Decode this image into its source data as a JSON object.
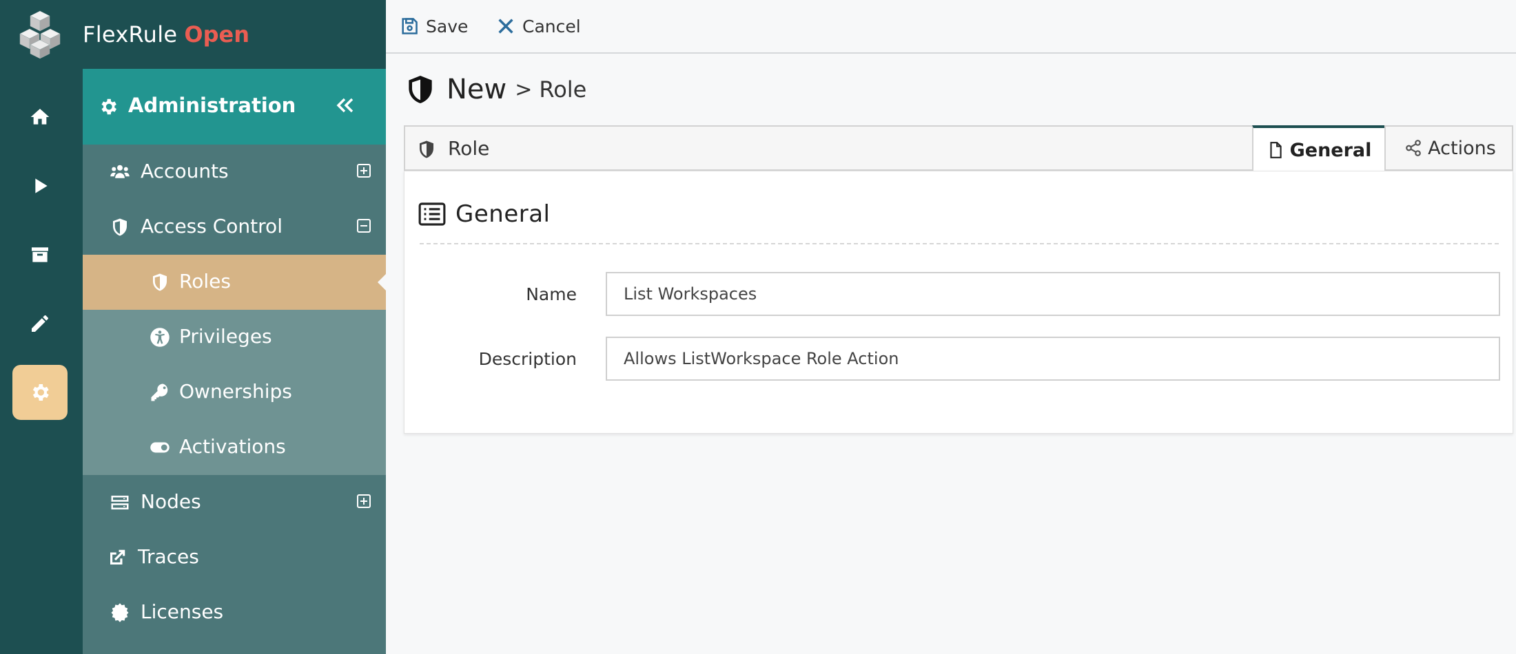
{
  "brand": {
    "name": "FlexRule",
    "accent_word": "Open",
    "colors": {
      "rail": "#1d4f51",
      "accent": "#ea5d52",
      "active": "#f1cd96"
    }
  },
  "rail": {
    "items": [
      {
        "icon": "home-icon",
        "active": false
      },
      {
        "icon": "play-icon",
        "active": false
      },
      {
        "icon": "archive-icon",
        "active": false
      },
      {
        "icon": "pencil-icon",
        "active": false
      },
      {
        "icon": "gear-icon",
        "active": true
      }
    ]
  },
  "sidebar": {
    "title": "Administration",
    "items": [
      {
        "label": "Accounts",
        "icon": "users-icon",
        "toggle": "expand"
      },
      {
        "label": "Access Control",
        "icon": "shield-icon",
        "toggle": "collapse"
      },
      {
        "label": "Roles",
        "icon": "shield-icon",
        "selected": true
      },
      {
        "label": "Privileges",
        "icon": "universal-access-icon"
      },
      {
        "label": "Ownerships",
        "icon": "key-icon"
      },
      {
        "label": "Activations",
        "icon": "toggle-icon"
      },
      {
        "label": "Nodes",
        "icon": "server-icon",
        "toggle": "expand"
      },
      {
        "label": "Traces",
        "icon": "external-link-icon"
      },
      {
        "label": "Licenses",
        "icon": "certificate-icon"
      }
    ]
  },
  "toolbar": {
    "save_label": "Save",
    "cancel_label": "Cancel"
  },
  "page": {
    "title_new": "New",
    "separator": ">",
    "title_entity": "Role"
  },
  "tabs": {
    "record_label": "Role",
    "items": [
      {
        "label": "General",
        "icon": "file-icon",
        "active": true
      },
      {
        "label": "Actions",
        "icon": "share-nodes-icon",
        "active": false
      }
    ]
  },
  "form": {
    "section_title": "General",
    "fields": [
      {
        "label": "Name",
        "value": "List Workspaces"
      },
      {
        "label": "Description",
        "value": "Allows ListWorkspace Role Action"
      }
    ]
  }
}
